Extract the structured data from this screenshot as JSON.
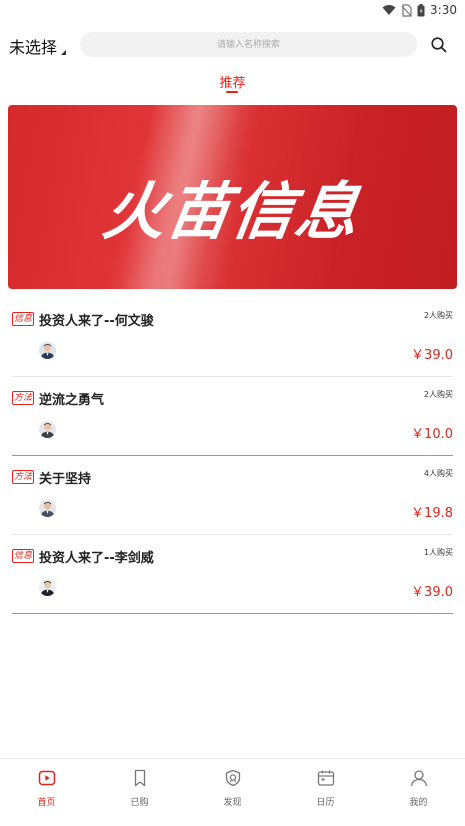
{
  "status_bar": {
    "time": "3:30"
  },
  "header": {
    "city_label": "未选择",
    "search_placeholder": "请输入名称搜索"
  },
  "tabs": [
    {
      "label": "推荐",
      "active": true
    }
  ],
  "banner": {
    "title": "火苗信息"
  },
  "items": [
    {
      "tag": "信息",
      "title": "投资人来了--何文骏",
      "buyers": "2人购买",
      "price": "￥39.0"
    },
    {
      "tag": "方法",
      "title": "逆流之勇气",
      "buyers": "2人购买",
      "price": "￥10.0"
    },
    {
      "tag": "方法",
      "title": "关于坚持",
      "buyers": "4人购买",
      "price": "￥19.8"
    },
    {
      "tag": "信息",
      "title": "投资人来了--李剑威",
      "buyers": "1人购买",
      "price": "￥39.0"
    }
  ],
  "bottom_nav": [
    {
      "label": "首页",
      "icon": "home-icon",
      "active": true
    },
    {
      "label": "已购",
      "icon": "bookmark-icon",
      "active": false
    },
    {
      "label": "发现",
      "icon": "discover-icon",
      "active": false
    },
    {
      "label": "日历",
      "icon": "calendar-icon",
      "active": false
    },
    {
      "label": "我的",
      "icon": "user-icon",
      "active": false
    }
  ],
  "colors": {
    "accent": "#e1251b",
    "banner": "#d32b2e"
  }
}
